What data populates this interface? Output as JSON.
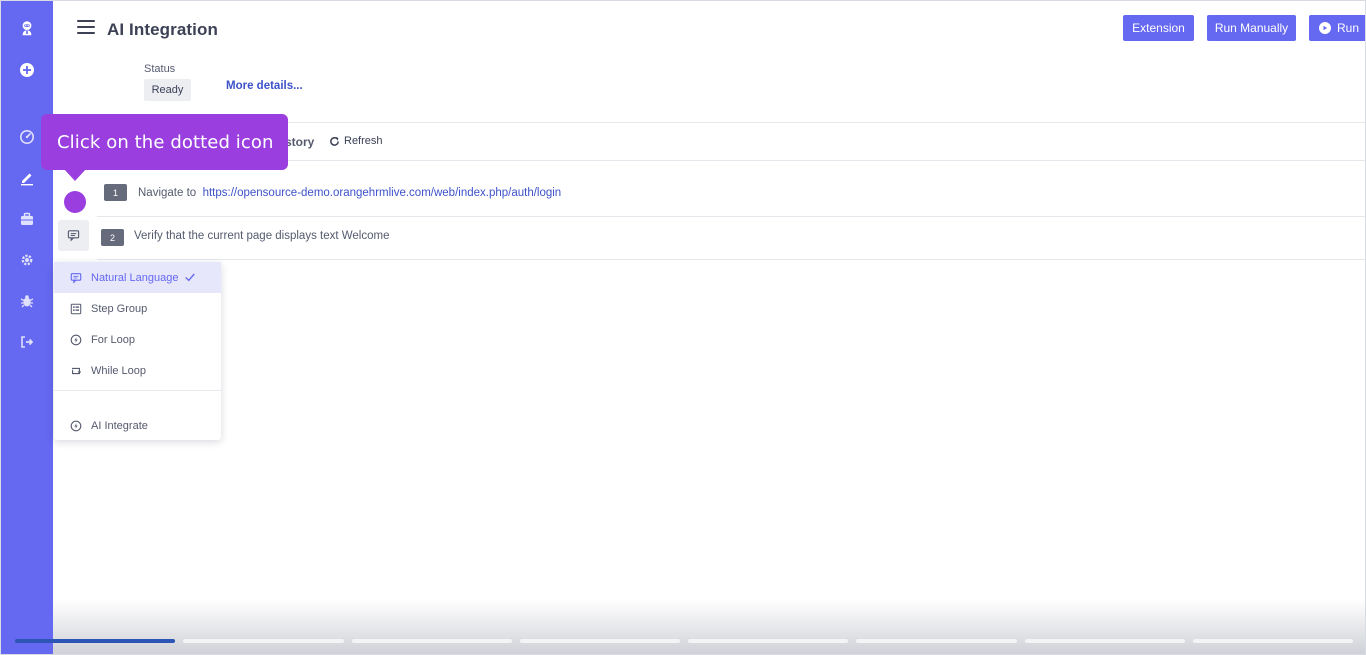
{
  "header": {
    "title": "AI Integration",
    "buttons": {
      "extension": "Extension",
      "run_manually": "Run Manually",
      "run": "Run"
    }
  },
  "status": {
    "label": "Status",
    "value": "Ready",
    "more_details": "More details..."
  },
  "tabs": {
    "history_fragment": "story",
    "refresh": "Refresh"
  },
  "steps": [
    {
      "number": "1",
      "action": "Navigate to",
      "link": "https://opensource-demo.orangehrmlive.com/web/index.php/auth/login"
    },
    {
      "number": "2",
      "text": "Verify that the current page displays text Welcome"
    }
  ],
  "tooltip": {
    "text": "Click on the dotted icon"
  },
  "dropdown": {
    "items": [
      {
        "label": "Natural Language",
        "icon": "chat-icon",
        "selected": true
      },
      {
        "label": "Step Group",
        "icon": "list-box-icon",
        "selected": false
      },
      {
        "label": "For Loop",
        "icon": "bolt-circle-icon",
        "selected": false
      },
      {
        "label": "While Loop",
        "icon": "loop-icon",
        "selected": false
      }
    ],
    "footer_items": [
      {
        "label": "AI Integrate",
        "icon": "bolt-circle-icon"
      }
    ]
  },
  "sidebar": {
    "icons": [
      "robot-logo-icon",
      "add-circle-icon",
      "dashboard-gauge-icon",
      "edit-pen-icon",
      "briefcase-icon",
      "settings-gear-icon",
      "bug-icon",
      "logout-icon"
    ]
  },
  "progress": {
    "total_segments": 8,
    "completed_segments": 1
  },
  "colors": {
    "accent": "#6568f0",
    "tooltip": "#9b3ee0",
    "link": "#3d52c9",
    "progress_done": "#2c55b5"
  }
}
